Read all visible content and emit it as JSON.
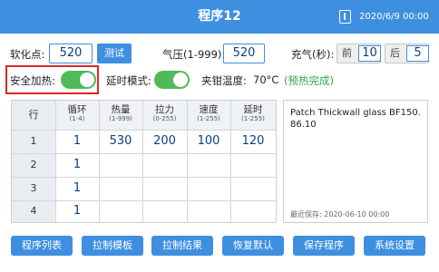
{
  "header": {
    "title": "程序12",
    "datetime": "2020/6/9 00:00",
    "icon": "thermometer-icon"
  },
  "settings": {
    "softening_point_label": "软化点:",
    "softening_point_value": "520",
    "test_button": "测试",
    "air_pressure_label": "气压(1-999):",
    "air_pressure_value": "520",
    "inflate_label": "充气(秒):",
    "inflate_front_label": "前",
    "inflate_front_value": "10",
    "inflate_back_label": "后",
    "inflate_back_value": "5"
  },
  "options": {
    "safe_heating_label": "安全加热:",
    "safe_heating_on": true,
    "delay_mode_label": "延时模式:",
    "delay_mode_on": true,
    "clamp_temp_label": "夹钳温度:",
    "clamp_temp_value": "70°C",
    "preheat_status": "(预热完成)"
  },
  "table": {
    "row_header": "行",
    "columns": [
      {
        "label": "循环",
        "range": "(1-4)"
      },
      {
        "label": "热量",
        "range": "(1-999)"
      },
      {
        "label": "拉力",
        "range": "(0-255)"
      },
      {
        "label": "速度",
        "range": "(1-255)"
      },
      {
        "label": "延时",
        "range": "(1-255)"
      }
    ],
    "rows": [
      {
        "index": "1",
        "cells": [
          "1",
          "530",
          "200",
          "100",
          "120"
        ]
      },
      {
        "index": "2",
        "cells": [
          "1",
          "",
          "",
          "",
          ""
        ]
      },
      {
        "index": "3",
        "cells": [
          "1",
          "",
          "",
          "",
          ""
        ]
      },
      {
        "index": "4",
        "cells": [
          "1",
          "",
          "",
          "",
          ""
        ]
      }
    ]
  },
  "notes": {
    "text": "Patch Thickwall glass BF150.86.10",
    "last_saved": "最近保存: 2020-06-10 00:00"
  },
  "footer": {
    "buttons": [
      "程序列表",
      "拉制模板",
      "拉制结果",
      "恢复默认",
      "保存程序",
      "系统设置"
    ]
  },
  "colors": {
    "accent": "#3f8fe0",
    "toggle_on": "#4fba5a",
    "highlight": "#e0242a",
    "status_ok": "#2ea44f",
    "value_text": "#0a3e7e"
  }
}
